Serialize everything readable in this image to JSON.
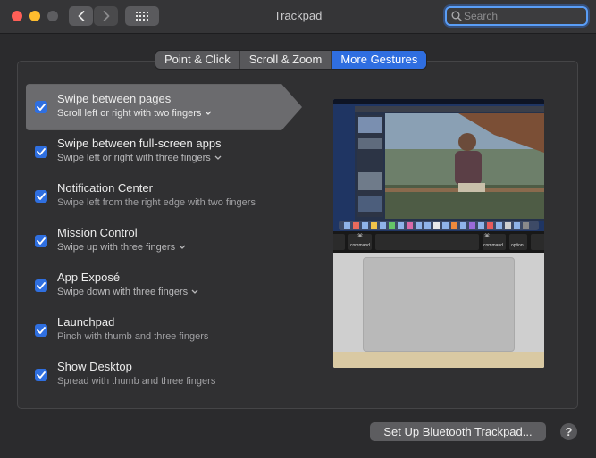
{
  "window": {
    "title": "Trackpad"
  },
  "toolbar": {
    "back_icon": "chevron-left-icon",
    "forward_icon": "chevron-right-icon",
    "grid_icon": "grid-icon"
  },
  "search": {
    "placeholder": "Search",
    "value": ""
  },
  "tabs": [
    {
      "label": "Point & Click",
      "active": false
    },
    {
      "label": "Scroll & Zoom",
      "active": false
    },
    {
      "label": "More Gestures",
      "active": true
    }
  ],
  "gestures": [
    {
      "title": "Swipe between pages",
      "subtitle": "Scroll left or right with two fingers",
      "has_menu": true,
      "checked": true,
      "selected": true
    },
    {
      "title": "Swipe between full-screen apps",
      "subtitle": "Swipe left or right with three fingers",
      "has_menu": true,
      "checked": true
    },
    {
      "title": "Notification Center",
      "subtitle": "Swipe left from the right edge with two fingers",
      "has_menu": false,
      "checked": true
    },
    {
      "title": "Mission Control",
      "subtitle": "Swipe up with three fingers",
      "has_menu": true,
      "checked": true
    },
    {
      "title": "App Exposé",
      "subtitle": "Swipe down with three fingers",
      "has_menu": true,
      "checked": true
    },
    {
      "title": "Launchpad",
      "subtitle": "Pinch with thumb and three fingers",
      "has_menu": false,
      "checked": true
    },
    {
      "title": "Show Desktop",
      "subtitle": "Spread with thumb and three fingers",
      "has_menu": false,
      "checked": true
    }
  ],
  "preview": {
    "keys": [
      "command",
      "command",
      "option"
    ],
    "key_symbol": "⌘"
  },
  "footer": {
    "bluetooth_button": "Set Up Bluetooth Trackpad...",
    "help": "?"
  },
  "colors": {
    "accent": "#2f6ee0",
    "window_bg": "#2b2b2d"
  }
}
